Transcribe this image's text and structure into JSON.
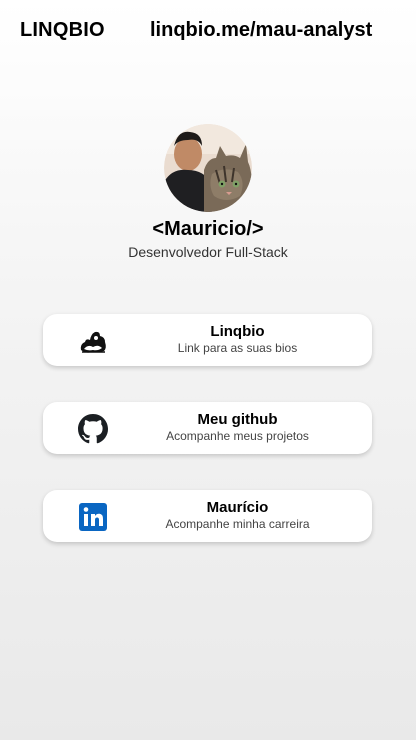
{
  "header": {
    "brand": "LINQBIO",
    "url": "linqbio.me/mau-analyst"
  },
  "profile": {
    "name": "<Mauricio/>",
    "role": "Desenvolvedor Full-Stack",
    "avatar_icon": "profile-photo"
  },
  "links": [
    {
      "title": "Linqbio",
      "subtitle": "Link para as suas bios",
      "icon": "linqbio-logo-icon"
    },
    {
      "title": "Meu github",
      "subtitle": "Acompanhe meus projetos",
      "icon": "github-icon"
    },
    {
      "title": "Maurício",
      "subtitle": "Acompanhe minha carreira",
      "icon": "linkedin-icon"
    }
  ],
  "colors": {
    "linkedin": "#0A66C2",
    "card_bg": "#ffffff"
  }
}
